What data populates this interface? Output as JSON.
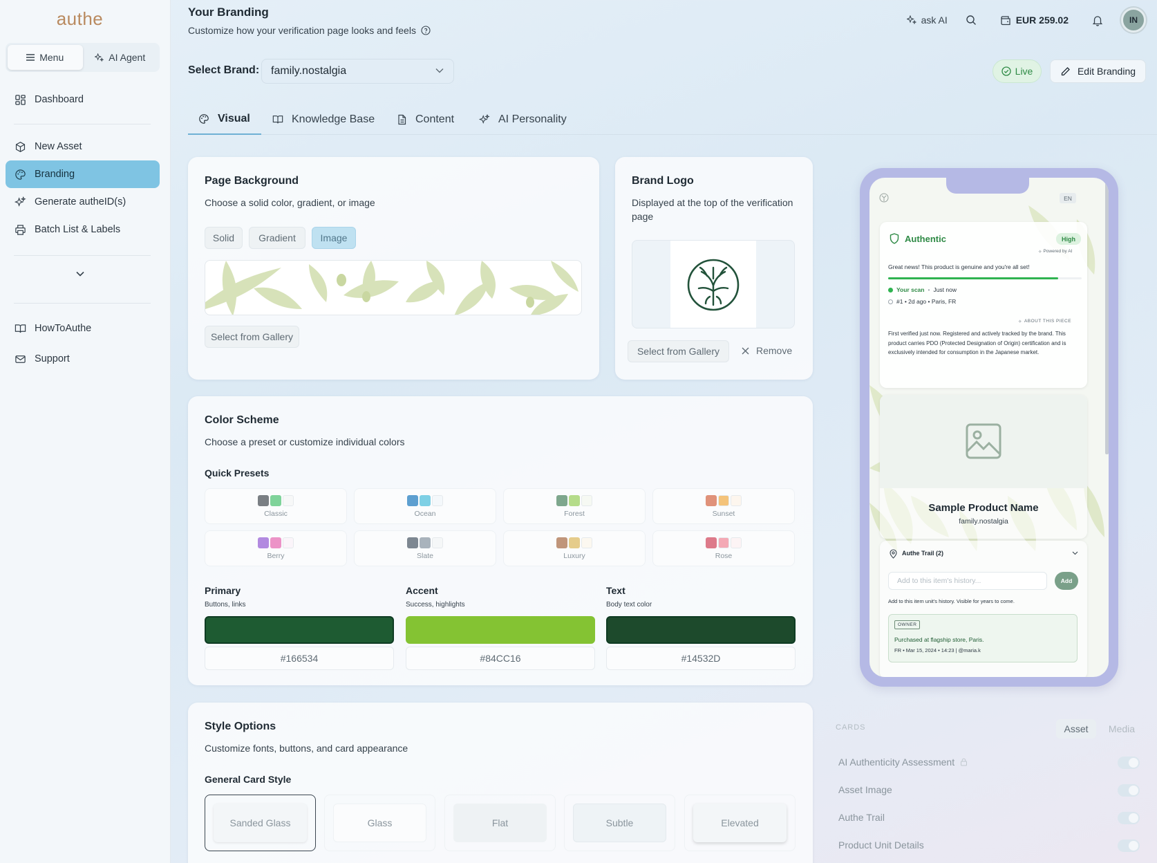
{
  "app": {
    "logo": "authe"
  },
  "sidebar": {
    "mode": {
      "menu": "Menu",
      "agent": "AI Agent"
    },
    "items": [
      {
        "label": "Dashboard"
      },
      {
        "label": "New Asset"
      },
      {
        "label": "Branding"
      },
      {
        "label": "Generate autheID(s)"
      },
      {
        "label": "Batch List & Labels"
      },
      {
        "label": "HowToAuthe"
      },
      {
        "label": "Support"
      }
    ]
  },
  "header": {
    "title": "Your Branding",
    "subtitle": "Customize how your verification page looks and feels",
    "ask_ai": "ask AI",
    "balance": "EUR 259.02",
    "avatar": "IN"
  },
  "brand": {
    "label": "Select Brand:",
    "value": "family.nostalgia",
    "status": "Live",
    "edit": "Edit Branding"
  },
  "tabs": [
    {
      "label": "Visual"
    },
    {
      "label": "Knowledge Base"
    },
    {
      "label": "Content"
    },
    {
      "label": "AI Personality"
    }
  ],
  "background": {
    "title": "Page Background",
    "subtitle": "Choose a solid color, gradient, or image",
    "options": [
      "Solid",
      "Gradient",
      "Image"
    ],
    "gallery": "Select from Gallery"
  },
  "logo_card": {
    "title": "Brand Logo",
    "subtitle": "Displayed at the top of the verification page",
    "gallery": "Select from Gallery",
    "remove": "Remove"
  },
  "colors": {
    "title": "Color Scheme",
    "subtitle": "Choose a preset or customize individual colors",
    "presets_label": "Quick Presets",
    "presets": [
      {
        "name": "Classic",
        "c": [
          "#7a7f84",
          "#7fd39a",
          "#f7f8f8"
        ]
      },
      {
        "name": "Ocean",
        "c": [
          "#5d9fd0",
          "#7ed0e5",
          "#f4f8fb"
        ]
      },
      {
        "name": "Forest",
        "c": [
          "#7ea78d",
          "#b5dc8a",
          "#f6f9f3"
        ]
      },
      {
        "name": "Sunset",
        "c": [
          "#e0927a",
          "#f4c37a",
          "#fdf6ee"
        ]
      },
      {
        "name": "Berry",
        "c": [
          "#b28ae0",
          "#ec93c7",
          "#fbf5fa"
        ]
      },
      {
        "name": "Slate",
        "c": [
          "#7d8791",
          "#a9b3bc",
          "#f5f7f8"
        ]
      },
      {
        "name": "Luxury",
        "c": [
          "#c0957a",
          "#e5cc8b",
          "#fcf8f0"
        ]
      },
      {
        "name": "Rose",
        "c": [
          "#dd7a8a",
          "#f4a9b5",
          "#fdf4f5"
        ]
      }
    ],
    "fields": [
      {
        "label": "Primary",
        "sub": "Buttons, links",
        "hex": "#166534",
        "color": "#1e5b32"
      },
      {
        "label": "Accent",
        "sub": "Success, highlights",
        "hex": "#84CC16",
        "color": "#84c333"
      },
      {
        "label": "Text",
        "sub": "Body text color",
        "hex": "#14532D",
        "color": "#1d4a2c"
      }
    ]
  },
  "style": {
    "title": "Style Options",
    "subtitle": "Customize fonts, buttons, and card appearance",
    "card_label": "General Card Style",
    "options": [
      "Sanded Glass",
      "Glass",
      "Flat",
      "Subtle",
      "Elevated"
    ]
  },
  "preview": {
    "lang": "EN",
    "authentic": "Authentic",
    "level": "High",
    "powered": "Powered by AI",
    "msg": "Great news! This product is genuine and you're all set!",
    "scan1_a": "Your scan",
    "scan1_b": "Just now",
    "scan2": "#1 • 2d ago • Paris, FR",
    "about": "ABOUT THIS PIECE",
    "about_text": "First verified just now. Registered and actively tracked by the brand. This product carries PDO (Protected Designation of Origin) certification and is exclusively intended for consumption in the Japanese market.",
    "product": "Sample Product Name",
    "brand": "family.nostalgia",
    "trail": "Authe Trail (2)",
    "add_placeholder": "Add to this item's history...",
    "add_btn": "Add",
    "add_note": "Add to this item unit's history. Visible for years to come.",
    "owner_badge": "OWNER",
    "owner_text": "Purchased at flagship store, Paris.",
    "owner_meta": "FR • Mar 15, 2024 • 14:23 | @maria.k"
  },
  "cards_panel": {
    "label": "CARDS",
    "seg": [
      "Asset",
      "Media"
    ],
    "rows": [
      "AI Authenticity Assessment",
      "Asset Image",
      "Authe Trail",
      "Product Unit Details"
    ]
  }
}
